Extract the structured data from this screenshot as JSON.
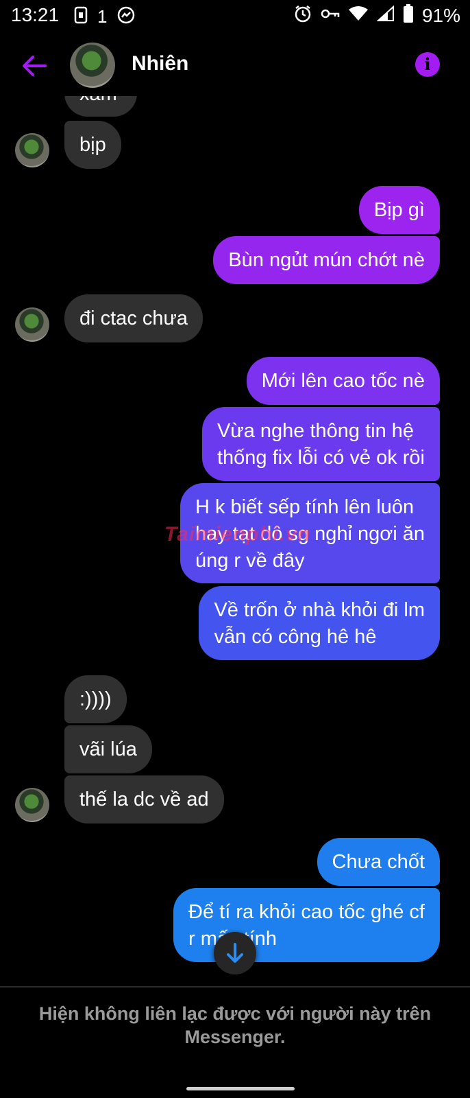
{
  "status_bar": {
    "time": "13:21",
    "extra_indicator": "1",
    "battery_percent": "91%",
    "icons": [
      "sim-card-icon",
      "messenger-notification-icon",
      "alarm-icon",
      "vpn-key-icon",
      "wifi-icon",
      "cellular-signal-icon",
      "battery-icon"
    ]
  },
  "header": {
    "contact_name": "Nhiên",
    "back_icon": "arrow-left-icon",
    "info_icon": "info-icon",
    "accent_color": "#a31cf2"
  },
  "messages": [
    {
      "dir": "in",
      "text": "xàm"
    },
    {
      "dir": "in",
      "text": "bịp"
    },
    {
      "dir": "out",
      "text": "Bịp gì"
    },
    {
      "dir": "out",
      "text": "Bùn ngủt mún chớt nè"
    },
    {
      "dir": "in",
      "text": "đi ctac chưa"
    },
    {
      "dir": "out",
      "text": "Mới lên cao tốc nè"
    },
    {
      "dir": "out",
      "text": "Vừa nghe thông tin hệ\nthống fix lỗi có vẻ ok rồi"
    },
    {
      "dir": "out",
      "text": "H k biết sếp tính lên luôn\nhay tạt dô sg nghỉ ngơi ăn\núng r về đây"
    },
    {
      "dir": "out",
      "text": "Về trốn ở nhà khỏi đi lm\nvẫn có công hê hê"
    },
    {
      "dir": "in",
      "text": ":))))"
    },
    {
      "dir": "in",
      "text": "vãi lúa"
    },
    {
      "dir": "in",
      "text": "thế la dc về ad"
    },
    {
      "dir": "out",
      "text": "Chưa chốt"
    },
    {
      "dir": "out",
      "text": "Để tí ra khỏi cao tốc ghé cf\nr mấy           tính"
    }
  ],
  "watermark": "Taimienphi.vn",
  "scroll_down_icon": "arrow-down-icon",
  "footer": {
    "note": "Hiện không liên lạc được với người này trên Messenger."
  },
  "colors": {
    "incoming_bubble": "#303030",
    "outgoing_purple": "#9d24ee",
    "outgoing_blue": "#1f7ded",
    "background": "#000000"
  }
}
